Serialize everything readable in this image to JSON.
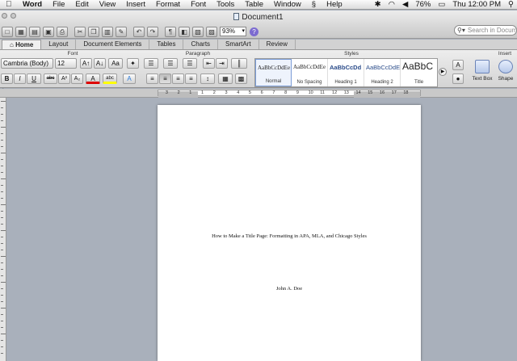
{
  "menubar": {
    "apple": "",
    "items": [
      "Word",
      "File",
      "Edit",
      "View",
      "Insert",
      "Format",
      "Font",
      "Tools",
      "Table",
      "Window",
      "",
      "Help"
    ],
    "status": {
      "battery": "76%",
      "clock": "Thu 12:00 PM"
    }
  },
  "window": {
    "title": "Document1",
    "zoom": "93%",
    "search_placeholder": "Search in Docum"
  },
  "tabs": [
    "Home",
    "Layout",
    "Document Elements",
    "Tables",
    "Charts",
    "SmartArt",
    "Review"
  ],
  "ribbon": {
    "groups": {
      "font": "Font",
      "paragraph": "Paragraph",
      "styles": "Styles",
      "insert": "Insert"
    },
    "font_name": "Cambria (Body)",
    "font_size": "12",
    "styles": [
      {
        "sample": "AaBbCcDdEe",
        "name": "Normal"
      },
      {
        "sample": "AaBbCcDdEe",
        "name": "No Spacing"
      },
      {
        "sample": "AaBbCcDd",
        "name": "Heading 1"
      },
      {
        "sample": "AaBbCcDdEe",
        "name": "Heading 2"
      },
      {
        "sample": "AaBbC",
        "name": "Title"
      }
    ],
    "insert": {
      "text_box": "Text Box",
      "shape": "Shape"
    }
  },
  "ruler": {
    "ticks": [
      "3",
      "2",
      "1",
      "1",
      "2",
      "3",
      "4",
      "5",
      "6",
      "7",
      "8",
      "9",
      "10",
      "11",
      "12",
      "13",
      "14",
      "15",
      "16",
      "17",
      "18"
    ]
  },
  "document": {
    "title_line": "How to Make a Title Page: Formatting in APA, MLA, and Chicago Styles",
    "author_line": "John A. Doe"
  }
}
